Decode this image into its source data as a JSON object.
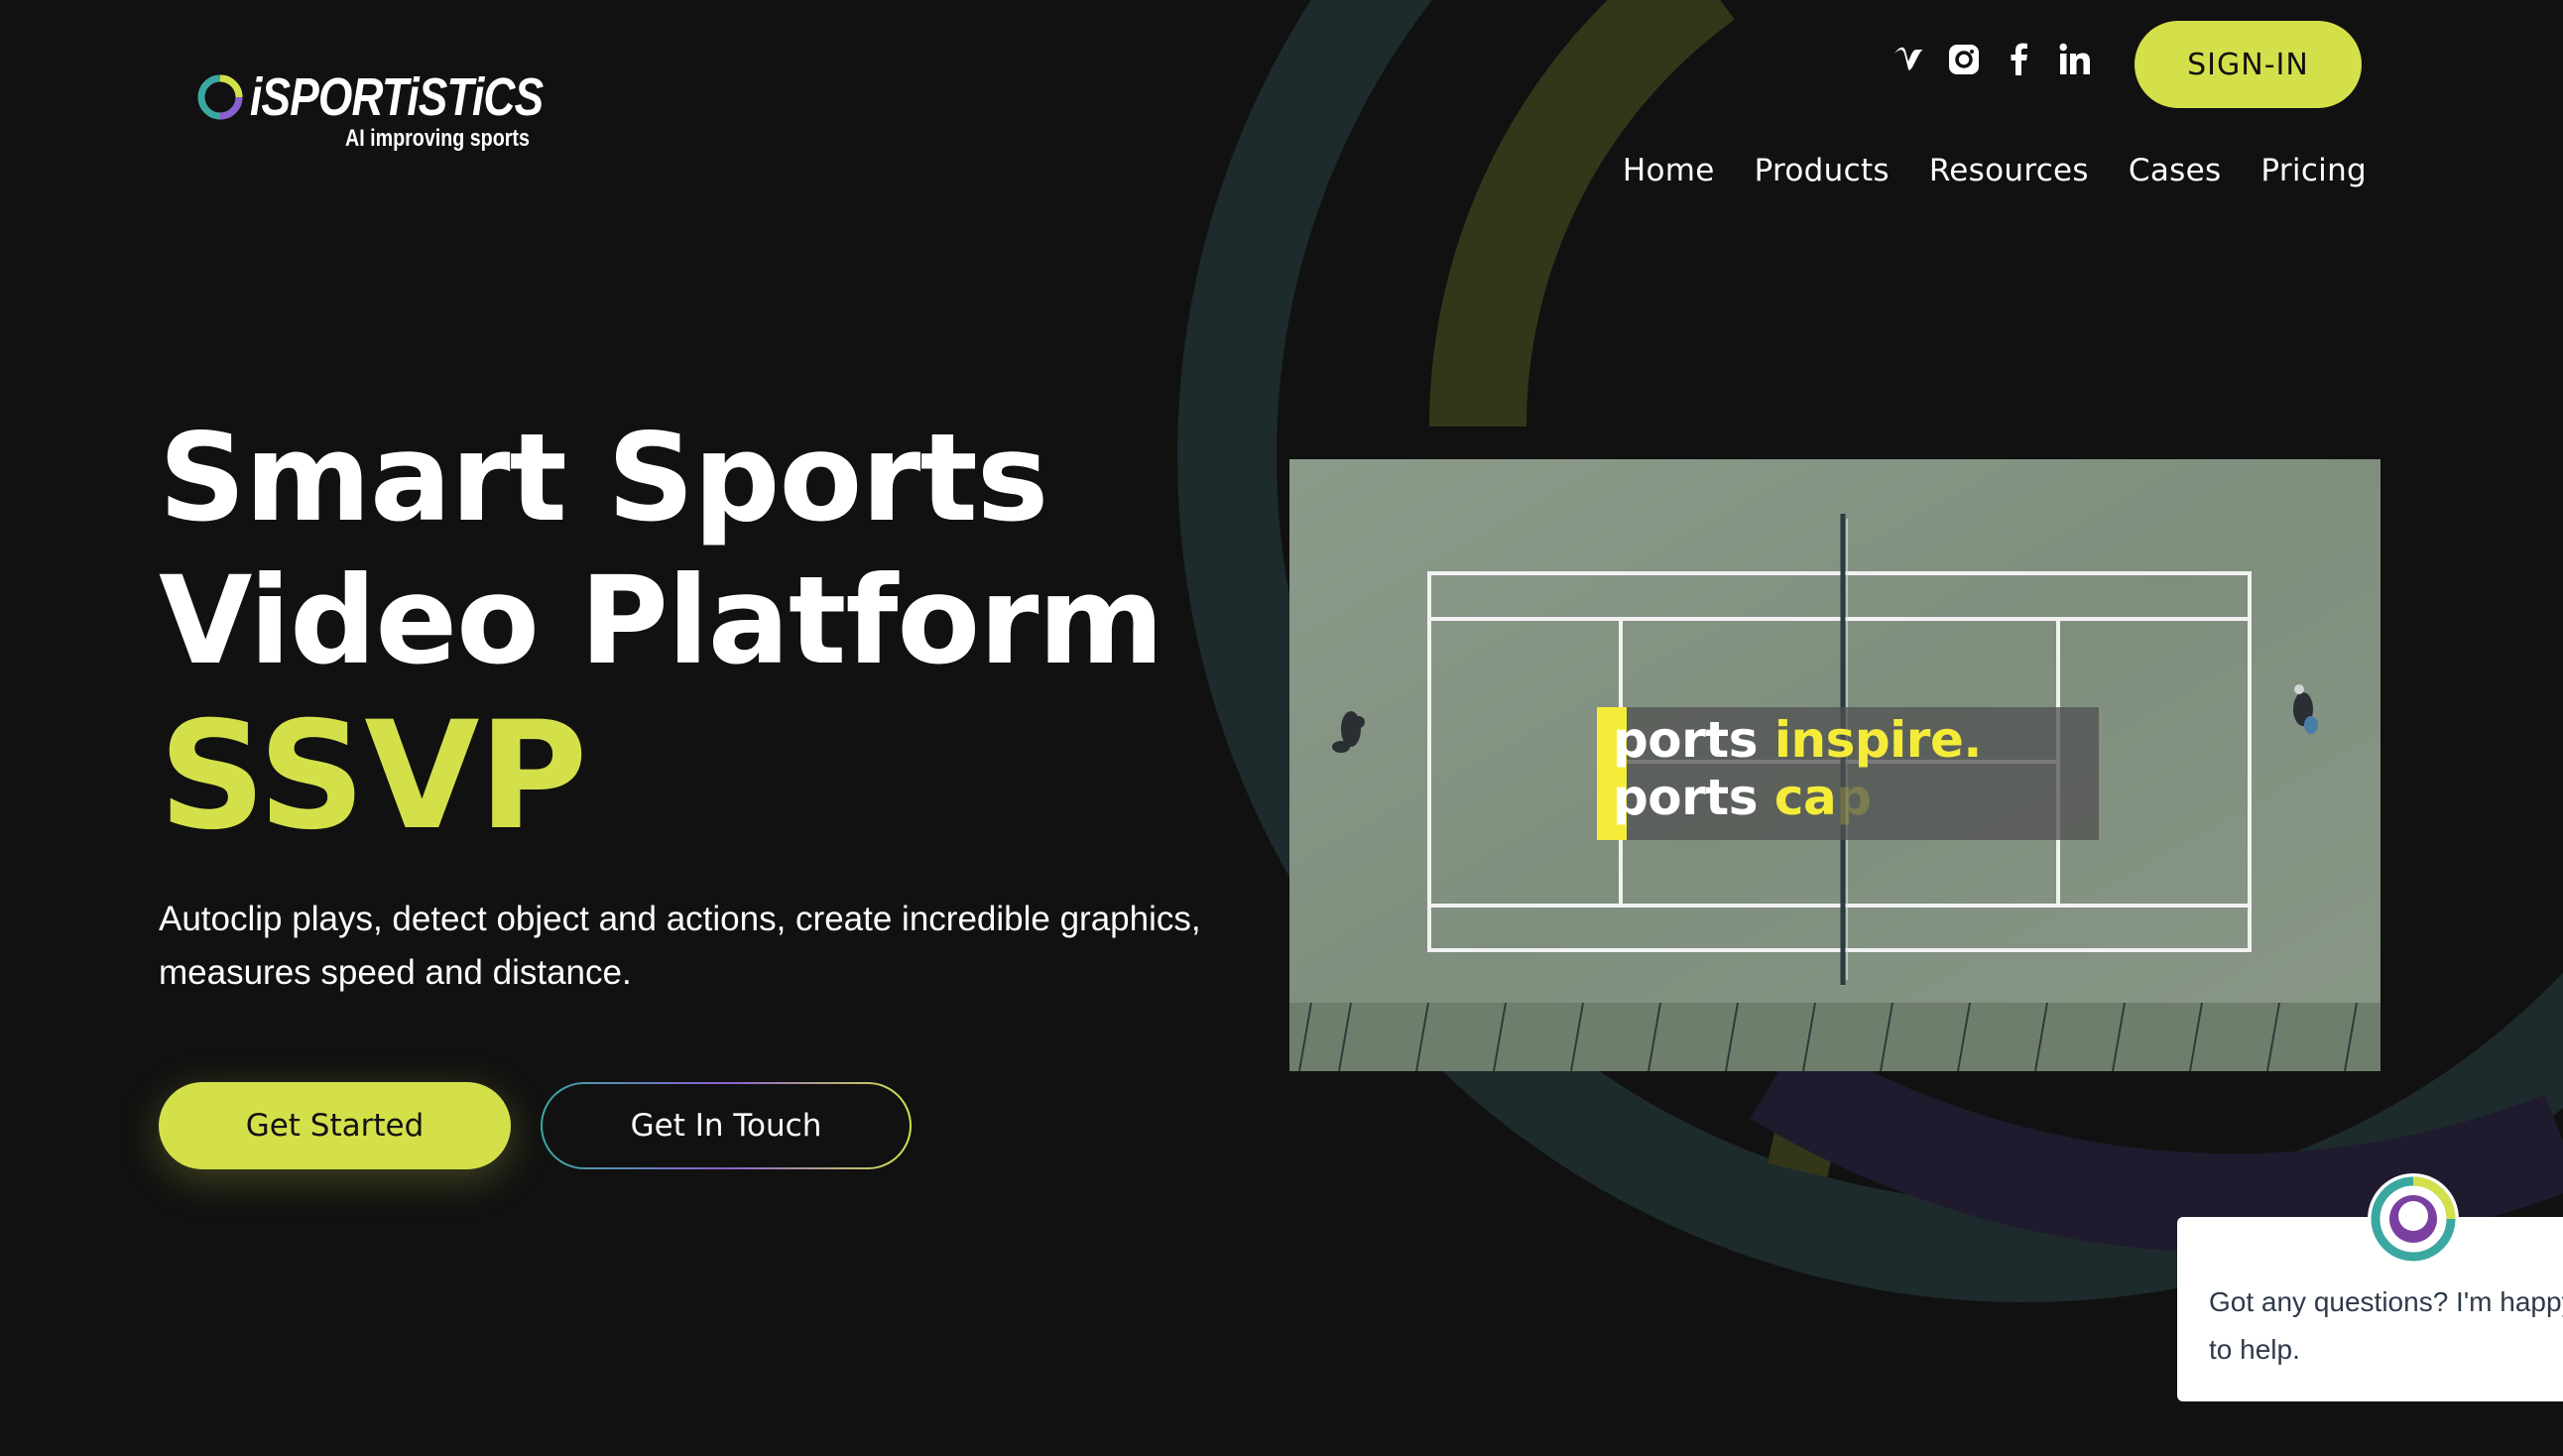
{
  "brand": {
    "name": "iSPORTiSTiCS",
    "tagline": "AI improving sports",
    "accent_color": "#d4e04a"
  },
  "header": {
    "social": [
      {
        "icon": "vimeo-icon",
        "label": "v"
      },
      {
        "icon": "instagram-icon",
        "label": ""
      },
      {
        "icon": "facebook-icon",
        "label": "f"
      },
      {
        "icon": "linkedin-icon",
        "label": "in"
      }
    ],
    "signin_label": "SIGN-IN",
    "nav": [
      "Home",
      "Products",
      "Resources",
      "Cases",
      "Pricing"
    ]
  },
  "hero": {
    "title_line1": "Smart Sports",
    "title_line2": "Video Platform",
    "title_accent": "SSVP",
    "description": "Autoclip plays, detect object and actions, create incredible graphics, measures speed and distance.",
    "primary_cta": "Get Started",
    "secondary_cta": "Get In Touch"
  },
  "video": {
    "caption_line1_white": "ports ",
    "caption_line1_yellow": "inspire.",
    "caption_line2_white": "ports ",
    "caption_line2_yellow": "ca",
    "caption_line2_fade": "p"
  },
  "chat": {
    "message": "Got any questions? I'm happy to help."
  }
}
